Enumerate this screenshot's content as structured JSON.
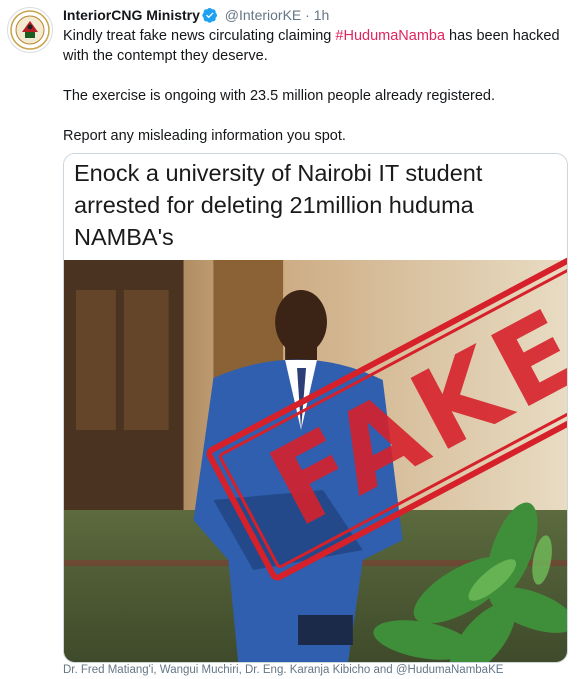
{
  "tweet": {
    "display_name": "InteriorCNG Ministry",
    "handle": "@InteriorKE",
    "separator": "·",
    "time": "1h",
    "text_before_hashtag": "Kindly treat fake news circulating claiming ",
    "hashtag": "#HudumaNamba",
    "text_after_hashtag": " has been hacked with the contempt they deserve.",
    "paragraph2": "The exercise is ongoing with 23.5 million people already registered.",
    "paragraph3": "Report any misleading information you spot.",
    "icons": {
      "avatar": "ministry-seal-icon",
      "verified": "verified-badge-icon"
    }
  },
  "media": {
    "headline": "Enock a university  of Nairobi IT student arrested for deleting 21million huduma NAMBA's",
    "stamp": "FAKE",
    "stamp_color": "#d6212b"
  },
  "caption": "Dr. Fred Matiang'i, Wangui Muchiri, Dr. Eng. Karanja Kibicho and @HudumaNambaKE",
  "colors": {
    "hashtag": "#e0245e",
    "verified": "#1da1f2",
    "muted": "#657786"
  }
}
